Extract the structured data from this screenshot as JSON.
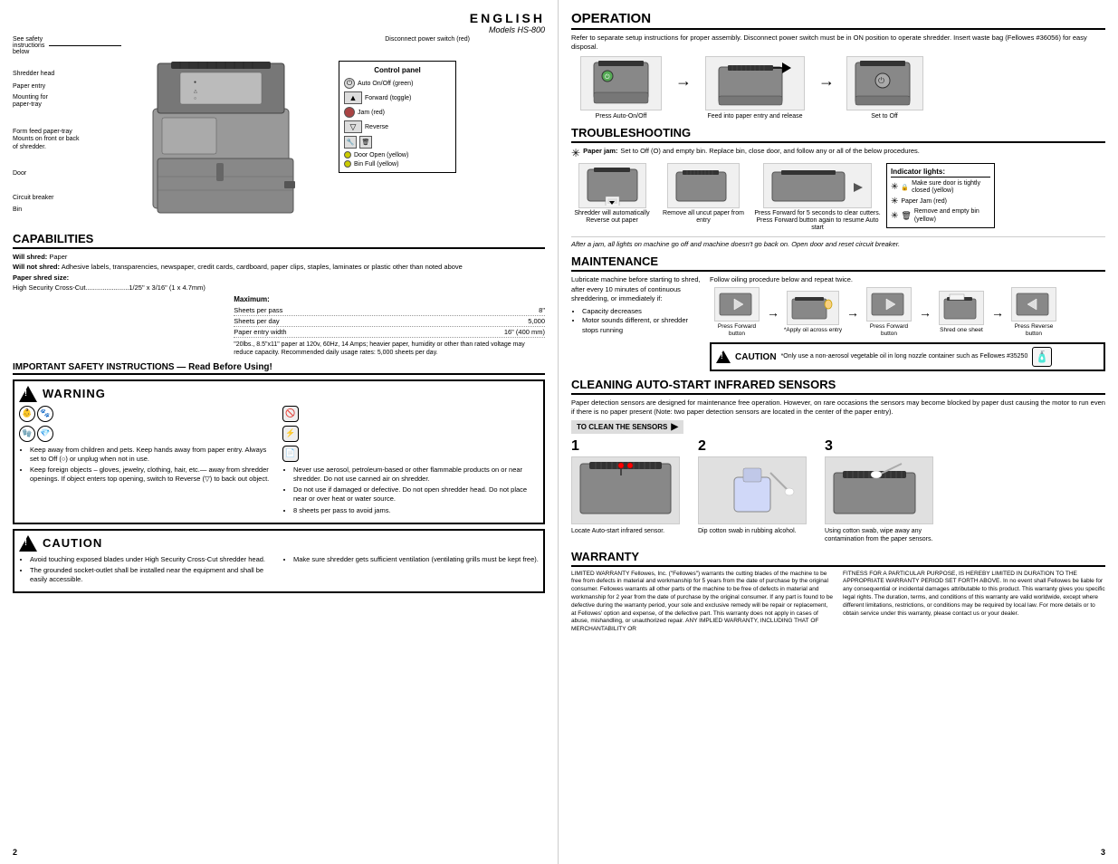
{
  "left_page": {
    "page_number": "2",
    "header": {
      "language": "ENGLISH",
      "models": "Models HS-800"
    },
    "diagram": {
      "labels": [
        "See safety instructions below",
        "Disconnect power switch (red)",
        "Control panel",
        "Shredder head",
        "Paper entry",
        "Mounting for paper-tray",
        "Form feed paper-tray Mounts on front or back of shredder.",
        "Door",
        "Circuit breaker",
        "Bin"
      ],
      "control_panel_label": "Control panel",
      "controls": [
        {
          "label": "Auto On/Off (green)",
          "type": "circle_green"
        },
        {
          "label": "Forward (toggle)",
          "type": "triangle_up"
        },
        {
          "label": "Jam (red)",
          "type": "circle_red"
        },
        {
          "label": "Reverse",
          "type": "triangle_down"
        },
        {
          "label": "Door Open (yellow)",
          "type": "circle_yellow"
        },
        {
          "label": "Bin Full (yellow)",
          "type": "circle_yellow"
        }
      ]
    },
    "capabilities": {
      "title": "CAPABILITIES",
      "will_shred": "Paper",
      "will_not_shred": "Adhesive labels, transparencies, newspaper, credit cards, cardboard, paper clips, staples, laminates or plastic other than noted above",
      "paper_shred_size_label": "Paper shred size:",
      "high_security": "High Security Cross-Cut.......................1/25\" x 3/16\" (1 x 4.7mm)",
      "maximum_label": "Maximum:",
      "sheets_per_pass": "8\"",
      "sheets_per_day": "5,000",
      "paper_entry_width": "16\" (400 mm)",
      "note": "\"20lbs., 8.5\"x11\" paper at 120v, 60Hz, 14 Amps; heavier paper, humidity or other than rated voltage may reduce capacity. Recommended daily usage rates: 5,000 sheets per day."
    },
    "safety": {
      "title": "IMPORTANT SAFETY INSTRUCTIONS — Read Before Using!",
      "warning_label": "WARNING",
      "warning_items_left": [
        "Keep away from children and pets. Keep hands away from paper entry. Always set to Off (○) or unplug when not in use.",
        "Keep foreign objects – gloves, jewelry, clothing, hair, etc.— away from shredder openings. If object enters top opening, switch to Reverse (▽) to back out object."
      ],
      "warning_items_right": [
        "Never use aerosol, petroleum-based or other flammable products on or near shredder. Do not use canned air on shredder.",
        "Do not use if damaged or defective. Do not open shredder head. Do not place near or over heat or water source.",
        "8 sheets per pass to avoid jams."
      ],
      "caution_label": "CAUTION",
      "caution_items_left": [
        "Avoid touching exposed blades under High Security Cross-Cut shredder head.",
        "The grounded socket-outlet shall be installed near the equipment and shall be easily accessible."
      ],
      "caution_items_right": [
        "Make sure shredder gets sufficient ventilation (ventilating grills must be kept free)."
      ]
    }
  },
  "right_page": {
    "page_number": "3",
    "operation": {
      "title": "OPERATION",
      "description": "Refer to separate setup instructions for proper assembly. Disconnect power switch must be in ON position to operate shredder. Insert waste bag (Fellowes #36056) for easy disposal.",
      "steps": [
        {
          "label": "Press Auto-On/Off"
        },
        {
          "label": "Feed into paper entry and release"
        },
        {
          "label": "Set to Off"
        }
      ]
    },
    "troubleshooting": {
      "title": "TROUBLESHOOTING",
      "paper_jam_label": "Paper jam:",
      "paper_jam_desc": "Set to Off (O) and empty bin. Replace bin, close door, and follow any or all of the below procedures.",
      "steps": [
        {
          "label": "Shredder will automatically Reverse out paper"
        },
        {
          "label": "Remove all uncut paper from entry"
        },
        {
          "label": "Press Forward for 5 seconds to clear cutters. Press Forward button again to resume Auto start"
        }
      ],
      "indicator_lights": {
        "title": "Indicator lights:",
        "items": [
          "Make sure door is tightly closed (yellow)",
          "Paper Jam (red)",
          "Remove and empty bin (yellow)"
        ]
      },
      "after_jam_note": "After a jam, all lights on machine go off and machine doesn't go back on. Open door and reset circuit breaker."
    },
    "maintenance": {
      "title": "MAINTENANCE",
      "instruction": "Lubricate machine before starting to shred, after every 10 minutes of continuous shreddering, or immediately if:",
      "bullet_items": [
        "Capacity decreases",
        "Motor sounds different, or shredder stops running"
      ],
      "procedure": "Follow oiling procedure below and repeat twice.",
      "steps": [
        {
          "label": "Press Forward button"
        },
        {
          "label": "*Apply oil across entry"
        },
        {
          "label": "Press Forward button"
        },
        {
          "label": "Shred one sheet"
        },
        {
          "label": "Press Reverse button"
        }
      ],
      "caution_text": "*Only use a non-aerosol vegetable oil in long nozzle container such as Fellowes #35250"
    },
    "cleaning": {
      "title": "CLEANING AUTO-START INFRARED SENSORS",
      "description": "Paper detection sensors are designed for maintenance free operation. However, on rare occasions the sensors may become blocked by paper dust causing the motor to run even if there is no paper present (Note: two paper detection sensors are located in the center of the paper entry).",
      "to_clean_label": "TO CLEAN THE SENSORS",
      "steps": [
        {
          "number": "1",
          "label": "Locate Auto-start infrared sensor."
        },
        {
          "number": "2",
          "label": "Dip cotton swab in rubbing alcohol."
        },
        {
          "number": "3",
          "label": "Using cotton swab, wipe away any contamination from the paper sensors."
        }
      ]
    },
    "warranty": {
      "title": "WARRANTY",
      "col1": "LIMITED WARRANTY Fellowes, Inc. (\"Fellowes\") warrants the cutting blades of the machine to be free from defects in material and workmanship for 5 years from the date of purchase by the original consumer. Fellowes warrants all other parts of the machine to be free of defects in material and workmanship for 2 year from the date of purchase by the original consumer. If any part is found to be defective during the warranty period, your sole and exclusive remedy will be repair or replacement, at Fellowes' option and expense, of the defective part. This warranty does not apply in cases of abuse, mishandling, or unauthorized repair. ANY IMPLIED WARRANTY, INCLUDING THAT OF MERCHANTABILITY OR",
      "col2": "FITNESS FOR A PARTICULAR PURPOSE, IS HEREBY LIMITED IN DURATION TO THE APPROPRIATE WARRANTY PERIOD SET FORTH ABOVE. In no event shall Fellowes be liable for any consequential or incidental damages attributable to this product. This warranty gives you specific legal rights. The duration, terms, and conditions of this warranty are valid worldwide, except where different limitations, restrictions, or conditions may be required by local law. For more details or to obtain service under this warranty, please contact us or your dealer."
    }
  }
}
